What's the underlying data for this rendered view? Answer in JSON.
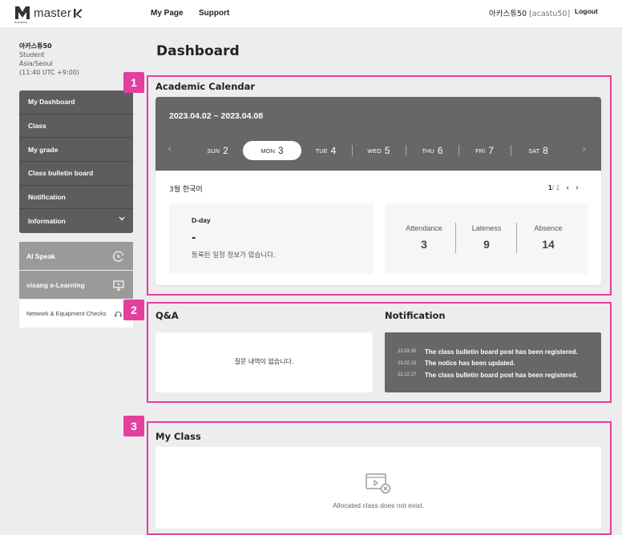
{
  "header": {
    "logo_text": "master",
    "logo_sub": "academy",
    "nav": [
      "My Page",
      "Support"
    ],
    "user_name": "아카스튜50",
    "user_id": "[acastu50]",
    "logout": "Logout"
  },
  "profile": {
    "name": "아카스튜50",
    "role": "Student",
    "timezone": "Asia/Seoul",
    "utc": "(11:40 UTC +9:00)"
  },
  "sidebar": {
    "menu": [
      "My Dashboard",
      "Class",
      "My grade",
      "Class bulletin board",
      "Notification",
      "Information"
    ],
    "external": [
      {
        "label": "AI Speak",
        "icon": "ai-speak-icon"
      },
      {
        "label": "visang e-Learning",
        "icon": "monitor-icon"
      }
    ],
    "network_check": "Network & Equipment Checks"
  },
  "main": {
    "title": "Dashboard",
    "badges": [
      "1",
      "2",
      "3"
    ],
    "calendar": {
      "title": "Academic Calendar",
      "range": "2023.04.02 ~ 2023.04.08",
      "days": [
        {
          "name": "SUN",
          "date": "2"
        },
        {
          "name": "MON",
          "date": "3",
          "selected": true
        },
        {
          "name": "TUE",
          "date": "4"
        },
        {
          "name": "WED",
          "date": "5"
        },
        {
          "name": "THU",
          "date": "6"
        },
        {
          "name": "FRI",
          "date": "7"
        },
        {
          "name": "SAT",
          "date": "8"
        }
      ],
      "course": "3월 한국어",
      "page_current": "1",
      "page_total": "/ 1",
      "dday_label": "D-day",
      "dday_value": "-",
      "dday_msg": "등록된 일정 정보가 없습니다.",
      "stats": [
        {
          "label": "Attendance",
          "value": "3"
        },
        {
          "label": "Lateness",
          "value": "9"
        },
        {
          "label": "Absence",
          "value": "14"
        }
      ]
    },
    "qa": {
      "title": "Q&A",
      "empty": "질문 내역이 없습니다."
    },
    "notification": {
      "title": "Notification",
      "items": [
        {
          "date": "23.03.30",
          "text": "The class bulletin board post has been registered."
        },
        {
          "date": "23.02.15",
          "text": "The notice has been updated."
        },
        {
          "date": "22.12.27",
          "text": "The class bulletin board post has been registered."
        }
      ]
    },
    "my_class": {
      "title": "My Class",
      "empty": "Allocated class does not exist."
    }
  },
  "colors": {
    "highlight": "#e2409c",
    "sidebar_menu": "#5d5d5d",
    "calendar_header": "#676767",
    "external_button": "#9a9a9a"
  }
}
